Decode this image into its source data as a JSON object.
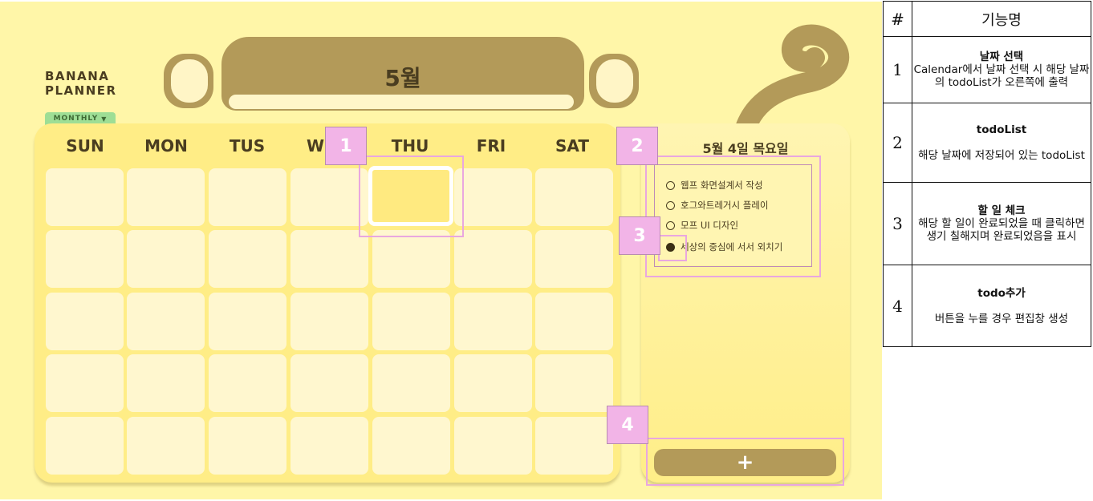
{
  "planner": {
    "logo_line1": "BANANA",
    "logo_line2": "PLANNER",
    "view_mode": "MONTHLY",
    "view_mode_arrow": "▼",
    "month_title": "5월",
    "weekdays": [
      "SUN",
      "MON",
      "TUS",
      "W",
      "THU",
      "FRI",
      "SAT"
    ],
    "selected_date_label": "5월 4일 목요일",
    "todos": [
      {
        "text": "웹프 화면설계서 작성",
        "done": false
      },
      {
        "text": "호그와트레거시 플레이",
        "done": false
      },
      {
        "text": "모프 UI 디자인",
        "done": false
      },
      {
        "text": "세상의 중심에 서서 외치기",
        "done": true
      }
    ],
    "add_button_label": "+"
  },
  "annotations": [
    "1",
    "2",
    "3",
    "4"
  ],
  "spec_table": {
    "header_num": "#",
    "header_name": "기능명",
    "rows": [
      {
        "num": "1",
        "name": "날짜 선택",
        "desc": "Calendar에서 날짜 선택 시 해당 날짜의 todoList가 오른쪽에 출력"
      },
      {
        "num": "2",
        "name": "todoList",
        "desc": "해당 날짜에 저장되어 있는 todoList"
      },
      {
        "num": "3",
        "name": "할 일 체크",
        "desc": "해당 할 일이 완료되었을 때 클릭하면 생기 칠해지며 완료되었음을 표시"
      },
      {
        "num": "4",
        "name": "todo추가",
        "desc": "버튼을 누를 경우 편집창 생성"
      }
    ]
  },
  "colors": {
    "background": "#fff6a8",
    "panel": "#ffed86",
    "accent_brown": "#b39a59",
    "text_dark": "#4a3d20",
    "annotation_pink": "#f2b4e7",
    "monthly_green": "#9ede95"
  }
}
